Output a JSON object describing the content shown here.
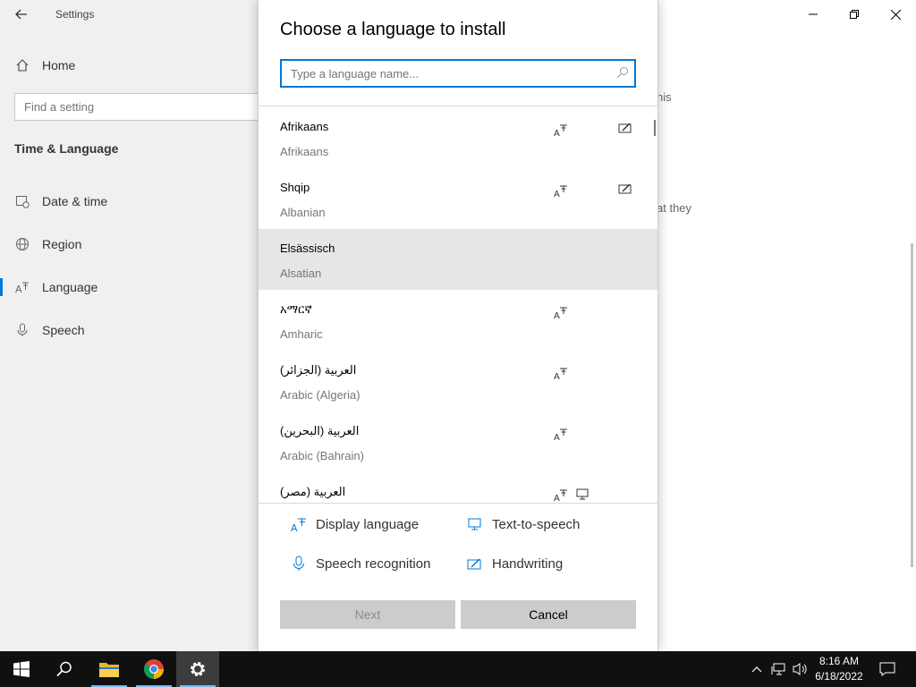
{
  "settings": {
    "app_title": "Settings",
    "home": "Home",
    "search_placeholder": "Find a setting",
    "section": "Time & Language",
    "nav": [
      {
        "label": "Date & time",
        "icon": "calendar-clock-icon"
      },
      {
        "label": "Region",
        "icon": "globe-icon"
      },
      {
        "label": "Language",
        "icon": "language-icon",
        "active": true
      },
      {
        "label": "Speech",
        "icon": "microphone-icon"
      }
    ],
    "bg_fragment_1": "his",
    "bg_fragment_2": "at they"
  },
  "dialog": {
    "title": "Choose a language to install",
    "search_placeholder": "Type a language name...",
    "languages": [
      {
        "native": "Afrikaans",
        "english": "Afrikaans",
        "features": [
          "display-language-icon",
          "handwriting-icon"
        ]
      },
      {
        "native": "Shqip",
        "english": "Albanian",
        "features": [
          "display-language-icon",
          "handwriting-icon"
        ]
      },
      {
        "native": "Elsässisch",
        "english": "Alsatian",
        "features": [],
        "selected": true
      },
      {
        "native": "አማርኛ",
        "english": "Amharic",
        "features": [
          "display-language-icon"
        ]
      },
      {
        "native": "العربية (الجزائر)",
        "english": "Arabic (Algeria)",
        "features": [
          "display-language-icon"
        ]
      },
      {
        "native": "العربية (البحرين)",
        "english": "Arabic (Bahrain)",
        "features": [
          "display-language-icon"
        ]
      },
      {
        "native": "العربية (مصر)",
        "english": "",
        "features": [
          "display-language-icon",
          "text-to-speech-icon"
        ]
      }
    ],
    "legend": {
      "display_language": "Display language",
      "text_to_speech": "Text-to-speech",
      "speech_recognition": "Speech recognition",
      "handwriting": "Handwriting"
    },
    "next_label": "Next",
    "cancel_label": "Cancel"
  },
  "taskbar": {
    "time": "8:16 AM",
    "date": "6/18/2022"
  },
  "colors": {
    "accent": "#0078d7",
    "taskbar": "#101010",
    "sidebar": "#f0f0f0",
    "selected_row": "#e6e6e6",
    "button": "#cccccc"
  }
}
